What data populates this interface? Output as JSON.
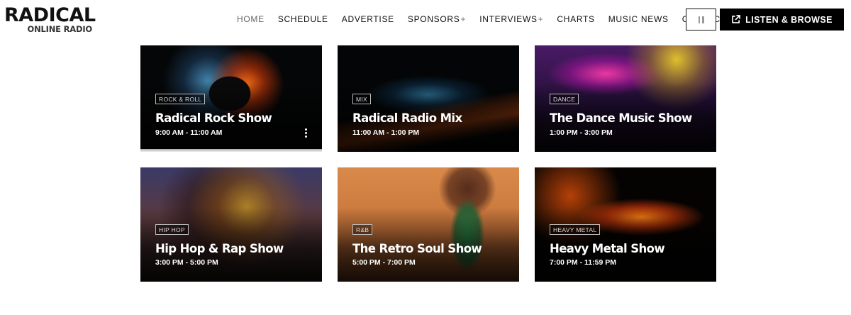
{
  "logo": {
    "main": "RADICAL",
    "sub": "ONLINE RADIO"
  },
  "nav": {
    "items": [
      {
        "label": "HOME",
        "active": true,
        "has_submenu": false
      },
      {
        "label": "SCHEDULE",
        "active": false,
        "has_submenu": false
      },
      {
        "label": "ADVERTISE",
        "active": false,
        "has_submenu": false
      },
      {
        "label": "SPONSORS",
        "active": false,
        "has_submenu": true
      },
      {
        "label": "INTERVIEWS",
        "active": false,
        "has_submenu": true
      },
      {
        "label": "CHARTS",
        "active": false,
        "has_submenu": false
      },
      {
        "label": "MUSIC NEWS",
        "active": false,
        "has_submenu": false
      },
      {
        "label": "CONTACT",
        "active": false,
        "has_submenu": false
      }
    ],
    "submenu_glyph": "+"
  },
  "player": {
    "pause_icon": "pause-icon",
    "listen_label": "LISTEN & BROWSE",
    "listen_icon": "external-link-icon"
  },
  "shows": [
    {
      "genre": "ROCK & ROLL",
      "title": "Radical Rock Show",
      "time": "9:00 AM - 11:00 AM",
      "has_menu": true
    },
    {
      "genre": "MIX",
      "title": "Radical Radio Mix",
      "time": "11:00 AM - 1:00 PM",
      "has_menu": false
    },
    {
      "genre": "DANCE",
      "title": "The Dance Music Show",
      "time": "1:00 PM - 3:00 PM",
      "has_menu": false
    },
    {
      "genre": "HIP HOP",
      "title": "Hip Hop & Rap Show",
      "time": "3:00 PM - 5:00 PM",
      "has_menu": false
    },
    {
      "genre": "R&B",
      "title": "The Retro Soul Show",
      "time": "5:00 PM - 7:00 PM",
      "has_menu": false
    },
    {
      "genre": "HEAVY METAL",
      "title": "Heavy Metal Show",
      "time": "7:00 PM - 11:59 PM",
      "has_menu": false
    }
  ],
  "colors": {
    "nav_text": "#111111",
    "nav_active": "#666666",
    "button_dark": "#000000"
  }
}
